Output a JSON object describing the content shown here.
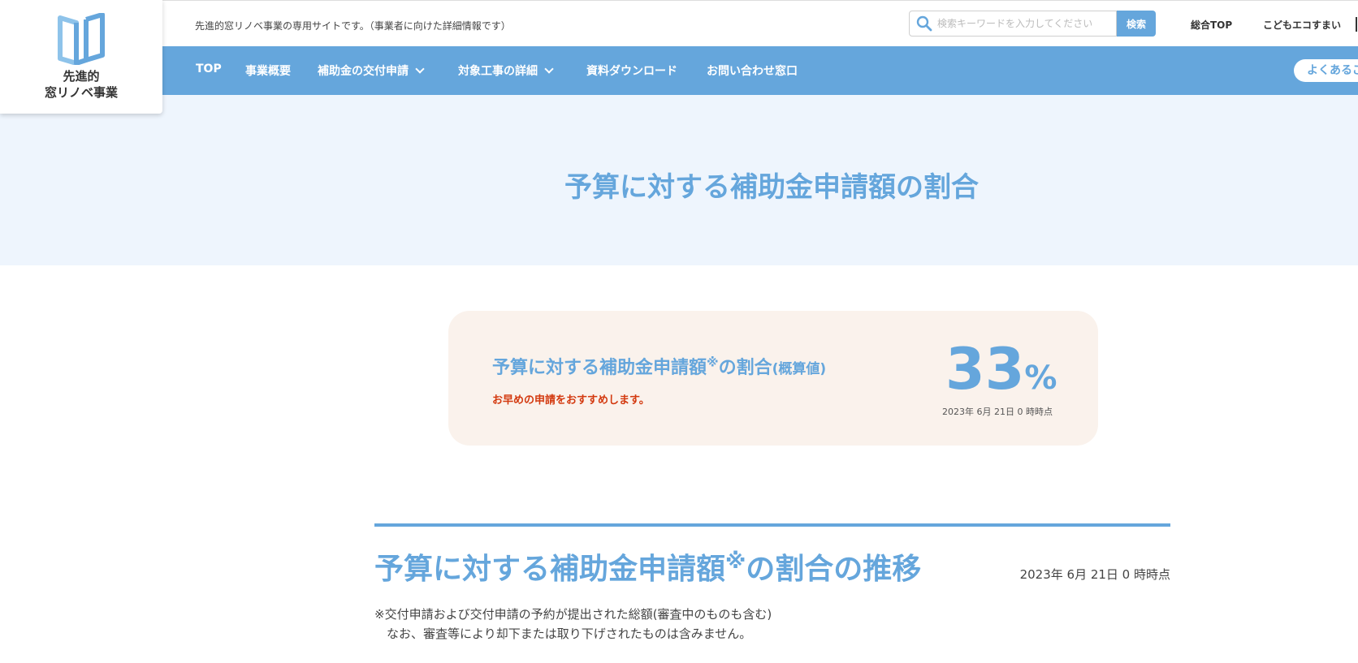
{
  "header": {
    "tagline": "先進的窓リノベ事業の専用サイトです。（事業者に向けた詳細情報です）",
    "search": {
      "placeholder": "検索キーワードを入力してください",
      "button_label": "検索",
      "icon": "search-icon"
    },
    "utility_links": [
      "総合TOP",
      "こどもエコすまい"
    ]
  },
  "logo": {
    "line1": "先進的",
    "line2": "窓リノベ事業",
    "icon": "window-logo-icon"
  },
  "nav": {
    "items": [
      {
        "label": "TOP",
        "dropdown": false
      },
      {
        "label": "事業概要",
        "dropdown": false
      },
      {
        "label": "補助金の交付申請",
        "dropdown": true
      },
      {
        "label": "対象工事の詳細",
        "dropdown": true
      },
      {
        "label": "資料ダウンロード",
        "dropdown": false
      },
      {
        "label": "お問い合わせ窓口",
        "dropdown": false
      }
    ],
    "faq_label": "よくあるご質問"
  },
  "hero": {
    "title": "予算に対する補助金申請額の割合"
  },
  "ratio_card": {
    "title_main": "予算に対する補助金申請額",
    "title_mark": "※",
    "title_tail": "の割合",
    "title_paren": "(概算値)",
    "note": "お早めの申請をおすすめします。",
    "value": "33",
    "unit": "%",
    "as_of": "2023年 6月 21日 0 時時点"
  },
  "trend": {
    "title_main": "予算に対する補助金申請額",
    "title_mark": "※",
    "title_tail": "の割合の推移",
    "as_of": "2023年 6月 21日 0 時時点",
    "note_line1": "※交付申請および交付申請の予約が提出された総額(審査中のものも含む)",
    "note_line2": "　なお、審査等により却下または取り下げされたものは含みません。"
  },
  "colors": {
    "accent": "#65a6dc",
    "hero_bg": "#eef5fd",
    "card_bg": "#faf2ec",
    "alert": "#d3390f"
  }
}
